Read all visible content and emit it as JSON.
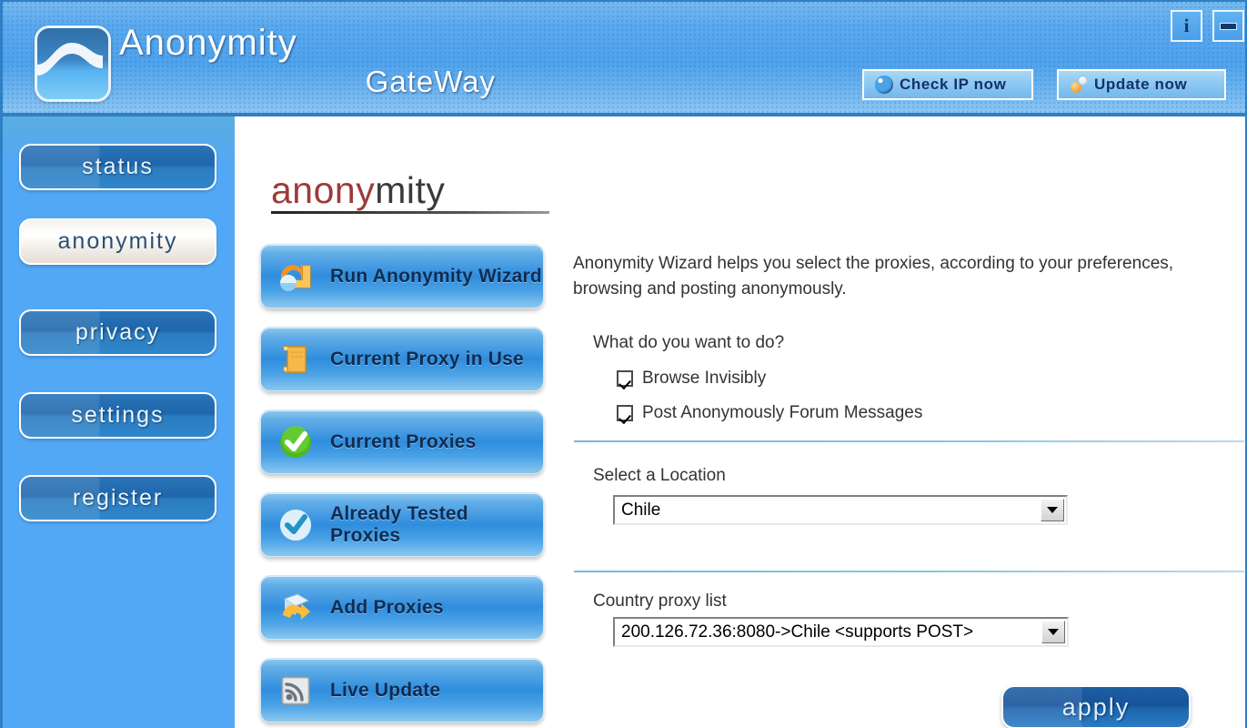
{
  "window": {
    "brand_line1": "Anonymity",
    "brand_line2": "GateWay",
    "info_glyph": "i",
    "check_ip_label": "Check IP now",
    "update_now_label": "Update now"
  },
  "sidebar": {
    "items": [
      {
        "label": "status",
        "active": false
      },
      {
        "label": "anonymity",
        "active": true
      },
      {
        "label": "privacy",
        "active": false
      },
      {
        "label": "settings",
        "active": false
      },
      {
        "label": "register",
        "active": false
      }
    ]
  },
  "page": {
    "title_part_red": "anony",
    "title_part_dark": "mity",
    "description": "Anonymity Wizard helps you select the proxies, according to your preferences, browsing and posting anonymously.",
    "question": "What do you want to do?"
  },
  "actions": [
    {
      "label": "Run Anonymity Wizard",
      "icon": "wizard-arrow-icon"
    },
    {
      "label": "Current Proxy in Use",
      "icon": "document-icon"
    },
    {
      "label": "Current Proxies",
      "icon": "green-check-icon"
    },
    {
      "label": "Already Tested Proxies",
      "icon": "blue-check-icon"
    },
    {
      "label": "Add Proxies",
      "icon": "add-folder-icon"
    },
    {
      "label": "Live Update",
      "icon": "rss-feed-icon"
    }
  ],
  "checkboxes": [
    {
      "label": "Browse Invisibly",
      "checked": true
    },
    {
      "label": "Post Anonymously Forum Messages",
      "checked": true
    }
  ],
  "location": {
    "label": "Select a Location",
    "selected": "Chile"
  },
  "proxy_list": {
    "label": "Country proxy list",
    "selected": "200.126.72.36:8080->Chile <supports POST>"
  },
  "apply_label": "apply",
  "colors": {
    "header_blue": "#4fa2ec",
    "sidebar_blue": "#53a8f5",
    "nav_button_blue": "#1f66ab",
    "action_button_blue": "#2f8ddd",
    "apply_blue": "#17539a",
    "title_red": "#9e3a3a",
    "separator_blue": "#8fc4e6"
  }
}
